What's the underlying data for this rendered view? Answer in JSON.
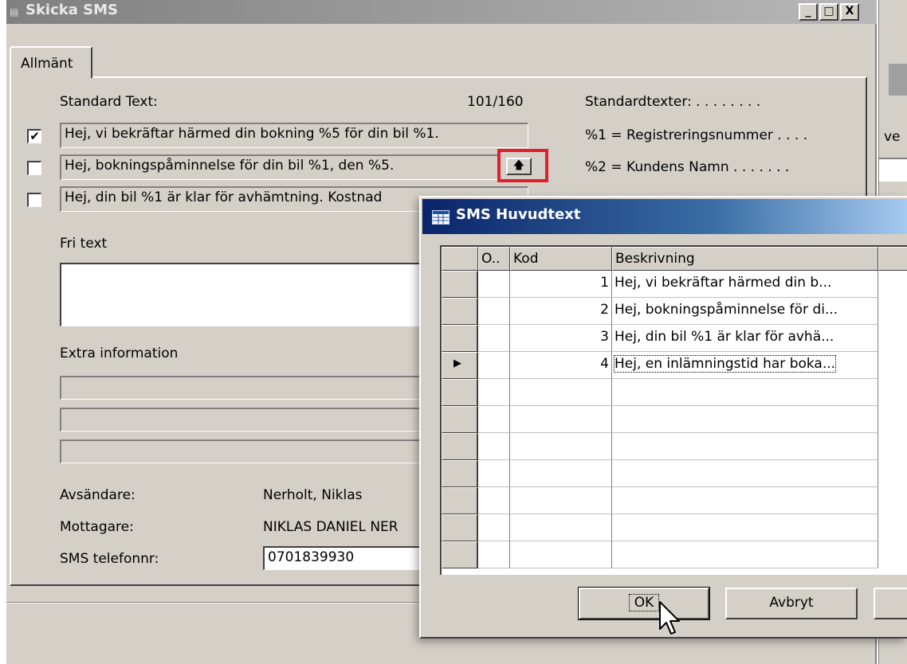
{
  "main_window": {
    "title": "Skicka SMS",
    "caption_buttons": [
      "_",
      "□",
      "X"
    ],
    "tab": "Allmänt",
    "standard_text_label": "Standard Text:",
    "char_count": "101/160",
    "standard_rows": [
      {
        "checked": "✔",
        "text": "Hej, vi bekräftar härmed din bokning %5 för din bil %1."
      },
      {
        "checked": "",
        "text": "Hej, bokningspåminnelse för din bil %1, den %5."
      },
      {
        "checked": "",
        "text": "Hej, din bil %1 är klar för avhämtning. Kostnad"
      }
    ],
    "assist_icon": "arrow-up-icon",
    "help_header": "Standardtexter: . . . . . . . .",
    "help_items": [
      "%1 = Registreringsnummer . . . .",
      "%2 = Kundens Namn . . . . . . ."
    ],
    "fri_text_label": "Fri text",
    "extra_info_label": "Extra information",
    "avsandare_label": "Avsändare:",
    "avsandare_value": "Nerholt, Niklas",
    "mottagare_label": "Mottagare:",
    "mottagare_value": "NIKLAS DANIEL NER",
    "telefon_label": "SMS telefonnr:",
    "telefon_value": "0701839930"
  },
  "background_fragment": "ve",
  "dialog": {
    "title": "SMS Huvudtext",
    "columns": [
      "O..",
      "Kod",
      "Beskrivning"
    ],
    "rows": [
      {
        "kod": "1",
        "beskrivning": "Hej, vi bekräftar härmed din b..."
      },
      {
        "kod": "2",
        "beskrivning": "Hej, bokningspåminnelse för di..."
      },
      {
        "kod": "3",
        "beskrivning": "Hej, din bil %1 är klar för avhä..."
      },
      {
        "kod": "4",
        "beskrivning": "Hej, en inlämningstid har boka..."
      }
    ],
    "current_row_marker": "▶",
    "ok_label": "OK",
    "cancel_label": "Avbryt"
  }
}
